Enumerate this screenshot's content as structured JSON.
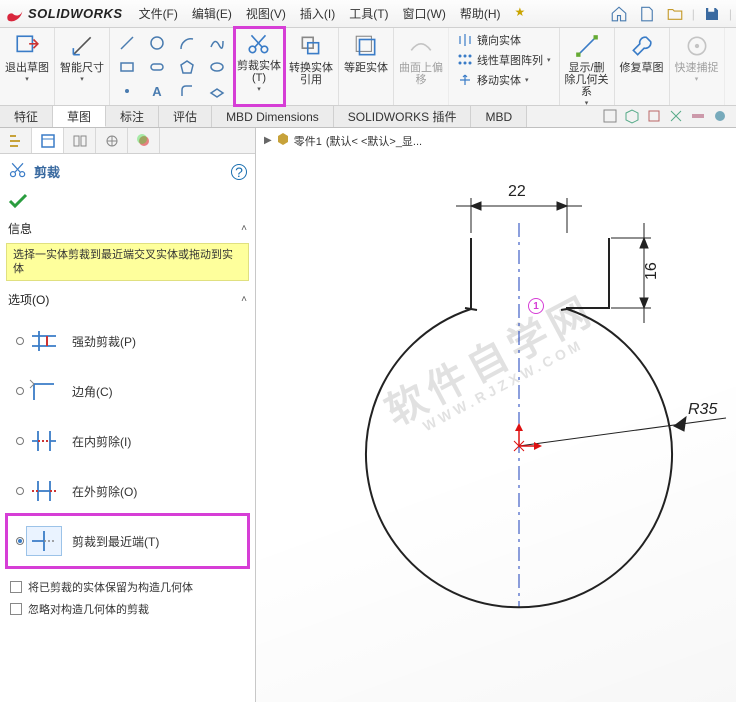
{
  "app": {
    "name": "SOLIDWORKS"
  },
  "menu": {
    "file": "文件(F)",
    "edit": "编辑(E)",
    "view": "视图(V)",
    "insert": "插入(I)",
    "tools": "工具(T)",
    "window": "窗口(W)",
    "help": "帮助(H)",
    "star": "★"
  },
  "ribbon": {
    "exit_sketch": "退出草图",
    "smart_dim": "智能尺寸",
    "trim": "剪裁实体(T)",
    "convert": "转换实体引用",
    "offset": "等距实体",
    "surface": "曲面上偏移",
    "mirror": "镜向实体",
    "pattern": "线性草图阵列",
    "move": "移动实体",
    "relations": "显示/删除几何关系",
    "repair": "修复草图",
    "quick_snap": "快速捕捉"
  },
  "tabs": {
    "items": [
      "特征",
      "草图",
      "标注",
      "评估",
      "MBD Dimensions",
      "SOLIDWORKS 插件",
      "MBD"
    ],
    "active_index": 1
  },
  "breadcrumb": {
    "part": "零件1",
    "config": "(默认< <默认>_显..."
  },
  "panel": {
    "title": "剪裁",
    "help": "?",
    "info_head": "信息",
    "info_text": "选择一实体剪裁到最近端交叉实体或拖动到实体",
    "options_head": "选项(O)",
    "options": [
      {
        "label": "强劲剪裁(P)"
      },
      {
        "label": "边角(C)"
      },
      {
        "label": "在内剪除(I)"
      },
      {
        "label": "在外剪除(O)"
      },
      {
        "label": "剪裁到最近端(T)"
      }
    ],
    "selected_option": 4,
    "check1": "将已剪裁的实体保留为构造几何体",
    "check2": "忽略对构造几何体的剪裁"
  },
  "sketch": {
    "dim_w": "22",
    "dim_h": "16",
    "radius": "R35",
    "point": "1"
  },
  "chart_data": {
    "type": "diagram",
    "note": "2D CAD sketch of flask profile",
    "circle": {
      "cx": 0,
      "cy": 0,
      "r": 35
    },
    "neck_width": 22,
    "neck_side_height": 16
  }
}
